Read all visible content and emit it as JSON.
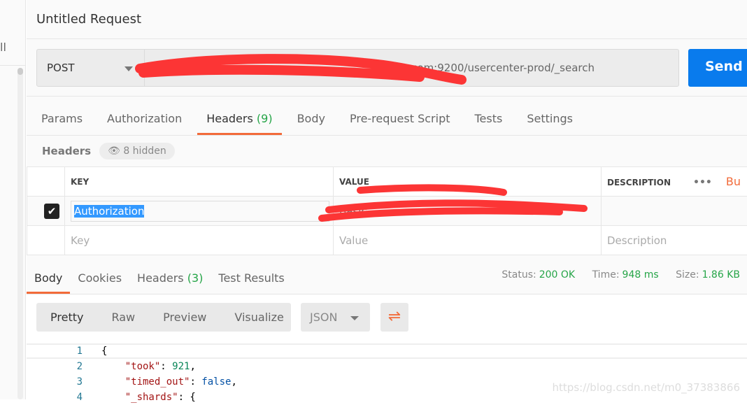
{
  "sidebar": {
    "partial_label": "ll"
  },
  "request": {
    "title": "Untitled Request",
    "method": "POST",
    "url_visible": ".com:9200/usercenter-prod/_search",
    "send_label": "Send"
  },
  "tabs": [
    {
      "label": "Params"
    },
    {
      "label": "Authorization"
    },
    {
      "label": "Headers",
      "count": "(9)"
    },
    {
      "label": "Body"
    },
    {
      "label": "Pre-request Script"
    },
    {
      "label": "Tests"
    },
    {
      "label": "Settings"
    }
  ],
  "headers": {
    "label": "Headers",
    "hidden": "8 hidden",
    "columns": {
      "key": "KEY",
      "value": "VALUE",
      "description": "DESCRIPTION",
      "more": "•••",
      "bulk": "Bu"
    },
    "rows": [
      {
        "checked": true,
        "key": "Authorization",
        "value": "Basic "
      }
    ],
    "placeholders": {
      "key": "Key",
      "value": "Value",
      "description": "Description"
    }
  },
  "response": {
    "tabs": [
      {
        "label": "Body"
      },
      {
        "label": "Cookies"
      },
      {
        "label": "Headers",
        "count": "(3)"
      },
      {
        "label": "Test Results"
      }
    ],
    "status_label": "Status:",
    "status": "200 OK",
    "time_label": "Time:",
    "time": "948 ms",
    "size_label": "Size:",
    "size": "1.86 KB",
    "views": [
      "Pretty",
      "Raw",
      "Preview",
      "Visualize"
    ],
    "format": "JSON",
    "code": [
      {
        "n": "1"
      },
      {
        "n": "2",
        "key": "\"took\"",
        "val": "921"
      },
      {
        "n": "3",
        "key": "\"timed_out\"",
        "val": "false"
      },
      {
        "n": "4",
        "key": "\"_shards\""
      }
    ]
  },
  "watermark": "https://blog.csdn.net/m0_37383866",
  "colors": {
    "accent": "#f26b3a",
    "send": "#097bed",
    "success": "#26a548"
  }
}
